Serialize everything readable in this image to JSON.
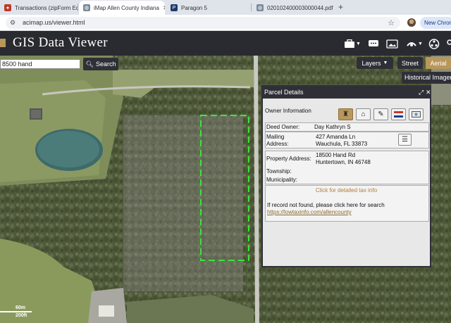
{
  "browser": {
    "tabs": [
      {
        "title": "Transactions (zipForm Edition",
        "favicon": "zipform-icon",
        "color": "#c0392b",
        "active": false
      },
      {
        "title": "iMap Allen County Indiana",
        "favicon": "globe-icon",
        "color": "#7a8a99",
        "active": true
      },
      {
        "title": "Paragon 5",
        "favicon": "paragon-icon",
        "color": "#1e3a6b",
        "active": false
      },
      {
        "title": "020102400003000044.pdf",
        "favicon": "globe-icon",
        "color": "#7a8a99",
        "active": false
      }
    ],
    "new_tab_symbol": "+",
    "url": "acimap.us/viewer.html",
    "new_chrome_label": "New Chrome"
  },
  "app": {
    "title": "GIS Data Viewer",
    "accent": "#b9975b",
    "header_icons": [
      "briefcase-icon",
      "chat-icon",
      "image-icon",
      "measure-icon",
      "share-icon",
      "settings-icon"
    ]
  },
  "search": {
    "value": "8500 hand",
    "button_label": "Search"
  },
  "map_controls": {
    "layers_label": "Layers",
    "street_label": "Street",
    "aerial_label": "Aerial",
    "historical_label": "Historical Imagery"
  },
  "scale": {
    "top": "60m",
    "bottom": "200ft"
  },
  "parcel": {
    "title": "Parcel Details",
    "section_title": "Owner Information",
    "tab_icons": [
      "tower-icon",
      "house-icon",
      "broom-icon",
      "flag-icon",
      "monitor-icon"
    ],
    "deed_owner_label": "Deed Owner:",
    "deed_owner": "Day Kathryn S",
    "mailing_label_1": "Mailing",
    "mailing_label_2": "Address:",
    "mailing_line1": "427 Amanda Ln",
    "mailing_line2": "Wauchula, FL 33873",
    "property_label": "Property Address:",
    "property_line1": "18500 Hand Rd",
    "property_line2": "Huntertown, IN 46748",
    "township_label": "Township:",
    "municipality_label": "Municipality:",
    "tax_link": "Click for detailed tax info",
    "not_found_text": "If record not found, please click here for search",
    "tax_url": "https://lowtaxinfo.com/allencounty"
  }
}
